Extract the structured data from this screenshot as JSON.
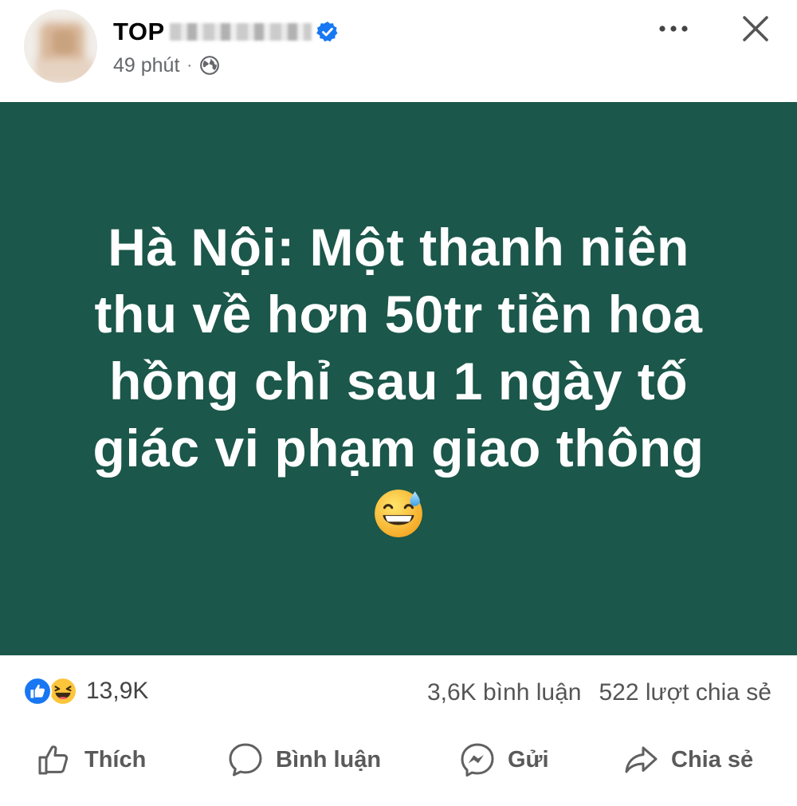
{
  "header": {
    "page_name": "TOP",
    "time": "49 phút",
    "separator": "·",
    "privacy_icon": "globe-icon",
    "verified_icon": "verified-badge-icon",
    "more_icon": "more-horizontal-icon",
    "close_icon": "close-icon"
  },
  "post": {
    "background": "#1b574a",
    "text_lines": [
      "Hà Nội: Một thanh niên",
      "thu về hơn 50tr tiền hoa",
      "hồng chỉ sau 1 ngày tố",
      "giác vi phạm giao thông"
    ],
    "emoji": "grinning-face-with-sweat-icon"
  },
  "stats": {
    "reactions_count": "13,9K",
    "comments": "3,6K bình luận",
    "shares": "522 lượt chia sẻ"
  },
  "actions": {
    "like_label": "Thích",
    "comment_label": "Bình luận",
    "send_label": "Gửi",
    "share_label": "Chia sẻ"
  },
  "colors": {
    "accent_blue": "#1877f2",
    "text_gray": "#65676b"
  }
}
